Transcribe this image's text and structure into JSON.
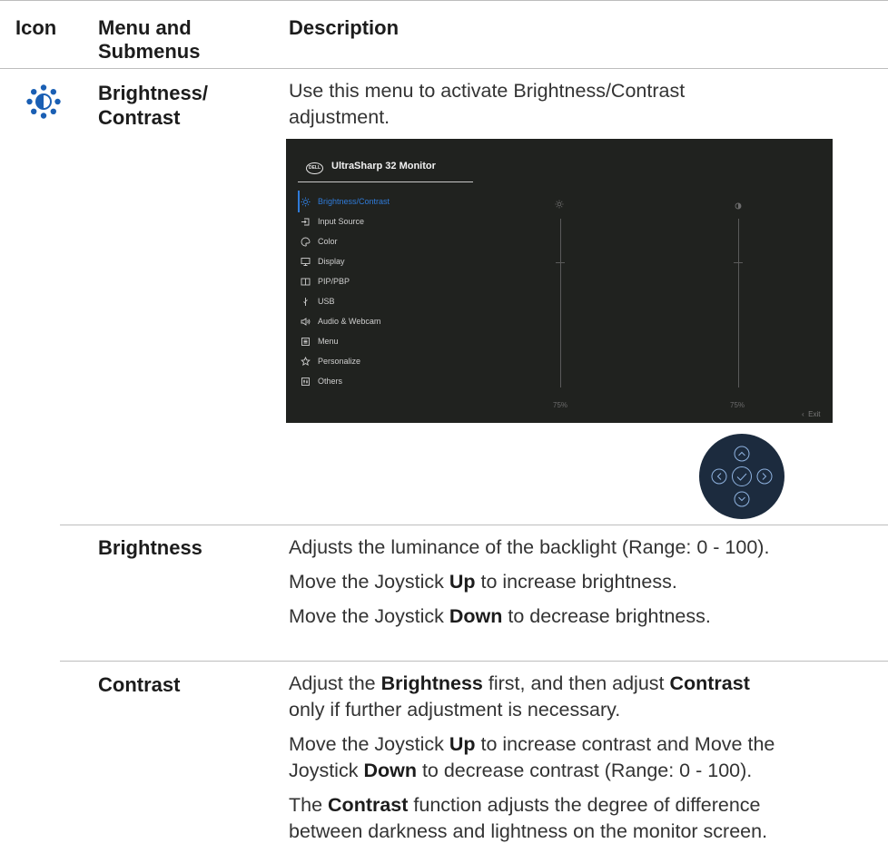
{
  "header": {
    "icon": "Icon",
    "menu_line1": "Menu and",
    "menu_line2": "Submenus",
    "description": "Description"
  },
  "section": {
    "icon_name": "brightness-contrast-icon",
    "icon_color": "#1a5fb4",
    "title_line1": "Brightness/",
    "title_line2": "Contrast",
    "intro_line1": "Use this menu to activate Brightness/Contrast",
    "intro_line2": "adjustment."
  },
  "osd": {
    "title": "UltraSharp 32 Monitor",
    "logo": "DELL",
    "menu_items": [
      {
        "label": "Brightness/Contrast",
        "icon": "sun-icon",
        "active": true
      },
      {
        "label": "Input Source",
        "icon": "input-source-icon",
        "active": false
      },
      {
        "label": "Color",
        "icon": "color-palette-icon",
        "active": false
      },
      {
        "label": "Display",
        "icon": "display-icon",
        "active": false
      },
      {
        "label": "PIP/PBP",
        "icon": "pip-pbp-icon",
        "active": false
      },
      {
        "label": "USB",
        "icon": "usb-icon",
        "active": false
      },
      {
        "label": "Audio & Webcam",
        "icon": "speaker-icon",
        "active": false
      },
      {
        "label": "Menu",
        "icon": "menu-icon",
        "active": false
      },
      {
        "label": "Personalize",
        "icon": "star-icon",
        "active": false
      },
      {
        "label": "Others",
        "icon": "others-icon",
        "active": false
      }
    ],
    "brightness_value": "75%",
    "contrast_value": "75%",
    "exit_label": "Exit",
    "accent": "#2f7bd9",
    "background": "#20221f"
  },
  "joystick": {
    "color": "#1c2b3e",
    "buttons": [
      "up",
      "left",
      "ok",
      "right",
      "down"
    ]
  },
  "brightness": {
    "label": "Brightness",
    "line1": "Adjusts the luminance of the backlight (Range: 0 - 100).",
    "line2_pre": "Move the Joystick ",
    "line2_bold": "Up",
    "line2_post": " to increase brightness.",
    "line3_pre": "Move the Joystick ",
    "line3_bold": "Down",
    "line3_post": " to decrease brightness."
  },
  "contrast": {
    "label": "Contrast",
    "p1_a": "Adjust the ",
    "p1_b": "Brightness",
    "p1_c": " first, and then adjust ",
    "p1_d": "Contrast",
    "p1_line2": "only if further adjustment is necessary.",
    "p2_a": "Move the Joystick ",
    "p2_b": "Up",
    "p2_c": " to increase contrast and Move the",
    "p2_d": "Joystick ",
    "p2_e": "Down",
    "p2_f": " to decrease contrast (Range: 0 - 100).",
    "p3_a": "The ",
    "p3_b": "Contrast",
    "p3_c": " function adjusts the degree of difference",
    "p3_line2": "between darkness and lightness on the monitor screen."
  }
}
